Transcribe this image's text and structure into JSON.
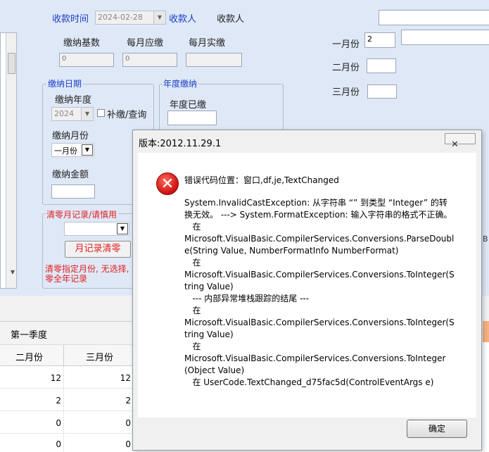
{
  "header": {
    "payment_time_label": "收款时间",
    "payment_time_value": "2024-02-28",
    "payee_label": "收款人",
    "payee_value": "收款人"
  },
  "amounts": {
    "base_label": "缴纳基数",
    "base_value": "0",
    "monthly_due_label": "每月应缴",
    "monthly_due_value": "0",
    "monthly_paid_label": "每月实缴",
    "monthly_paid_value": ""
  },
  "months_right": {
    "jan_label": "一月份",
    "jan_value": "2",
    "feb_label": "二月份",
    "mar_label": "三月份"
  },
  "payment_date_group": {
    "title": "缴纳日期",
    "year_label": "缴纳年度",
    "year_value": "2024",
    "supplement_label": "补缴/查询",
    "month_label": "缴纳月份",
    "month_value": "一月份",
    "amount_label": "缴纳金额"
  },
  "annual_group": {
    "title": "年度缴纳",
    "paid_label": "年度已缴"
  },
  "clear_group": {
    "title": "清零月记录/请慎用",
    "button_label": "月记录清零",
    "warning_line1": "清零指定月份, 无选择, 清",
    "warning_line2": "零全年记录"
  },
  "grid": {
    "quarter_header": "第一季度",
    "col_feb": "二月份",
    "col_mar": "三月份",
    "rows": [
      {
        "feb": "12",
        "mar": "12"
      },
      {
        "feb": "2",
        "mar": "2"
      },
      {
        "feb": "0",
        "mar": "0"
      },
      {
        "feb": "0",
        "mar": "0"
      }
    ]
  },
  "dialog": {
    "title": "版本:2012.11.29.1",
    "close_symbol": "✕",
    "error_location": "错误代码位置：窗口,df,je,TextChanged",
    "error_text": "System.InvalidCastException: 从字符串 “” 到类型 “Integer” 的转换无效。 ---> System.FormatException: 输入字符串的格式不正确。\n   在\nMicrosoft.VisualBasic.CompilerServices.Conversions.ParseDouble(String Value, NumberFormatInfo NumberFormat)\n   在\nMicrosoft.VisualBasic.CompilerServices.Conversions.ToInteger(String Value)\n   --- 内部异常堆栈跟踪的结尾 ---\n   在\nMicrosoft.VisualBasic.CompilerServices.Conversions.ToInteger(String Value)\n   在\nMicrosoft.VisualBasic.CompilerServices.Conversions.ToInteger(Object Value)\n   在 UserCode.TextChanged_d75fac5d(ControlEventArgs e)",
    "ok_label": "确定"
  },
  "edge_fragment": "B"
}
